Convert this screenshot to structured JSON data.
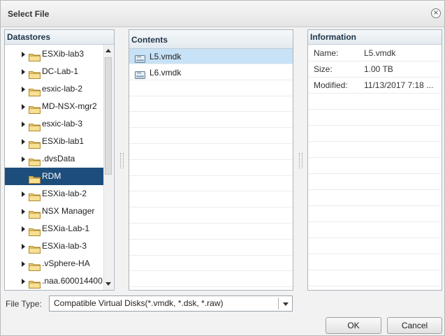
{
  "dialog": {
    "title": "Select File",
    "close_icon": "close-icon"
  },
  "datastores": {
    "header": "Datastores",
    "items": [
      {
        "label": "ESXib-lab3",
        "expandable": true,
        "selected": false
      },
      {
        "label": "DC-Lab-1",
        "expandable": true,
        "selected": false
      },
      {
        "label": "esxic-lab-2",
        "expandable": true,
        "selected": false
      },
      {
        "label": "MD-NSX-mgr2",
        "expandable": true,
        "selected": false
      },
      {
        "label": "esxic-lab-3",
        "expandable": true,
        "selected": false
      },
      {
        "label": "ESXib-lab1",
        "expandable": true,
        "selected": false
      },
      {
        "label": ".dvsData",
        "expandable": true,
        "selected": false
      },
      {
        "label": "RDM",
        "expandable": false,
        "selected": true
      },
      {
        "label": "ESXia-lab-2",
        "expandable": true,
        "selected": false
      },
      {
        "label": "NSX Manager",
        "expandable": true,
        "selected": false
      },
      {
        "label": "ESXia-Lab-1",
        "expandable": true,
        "selected": false
      },
      {
        "label": "ESXia-lab-3",
        "expandable": true,
        "selected": false
      },
      {
        "label": ".vSphere-HA",
        "expandable": true,
        "selected": false
      },
      {
        "label": ".naa.600014400",
        "expandable": true,
        "selected": false
      }
    ]
  },
  "contents": {
    "header": "Contents",
    "files": [
      {
        "label": "L5.vmdk",
        "icon": "virtual-disk-icon",
        "selected": true
      },
      {
        "label": "L6.vmdk",
        "icon": "virtual-disk-icon",
        "selected": false
      }
    ]
  },
  "information": {
    "header": "Information",
    "rows": [
      {
        "key": "Name:",
        "value": "L5.vmdk"
      },
      {
        "key": "Size:",
        "value": "1.00 TB"
      },
      {
        "key": "Modified:",
        "value": "11/13/2017 7:18 ..."
      }
    ]
  },
  "footer": {
    "file_type_label": "File Type:",
    "file_type_value": "Compatible Virtual Disks(*.vmdk, *.dsk, *.raw)",
    "ok_label": "OK",
    "cancel_label": "Cancel"
  },
  "colors": {
    "selected_tree": "#1d4e7b",
    "selected_file": "#c7e2f7",
    "header_text": "#1e3548"
  }
}
